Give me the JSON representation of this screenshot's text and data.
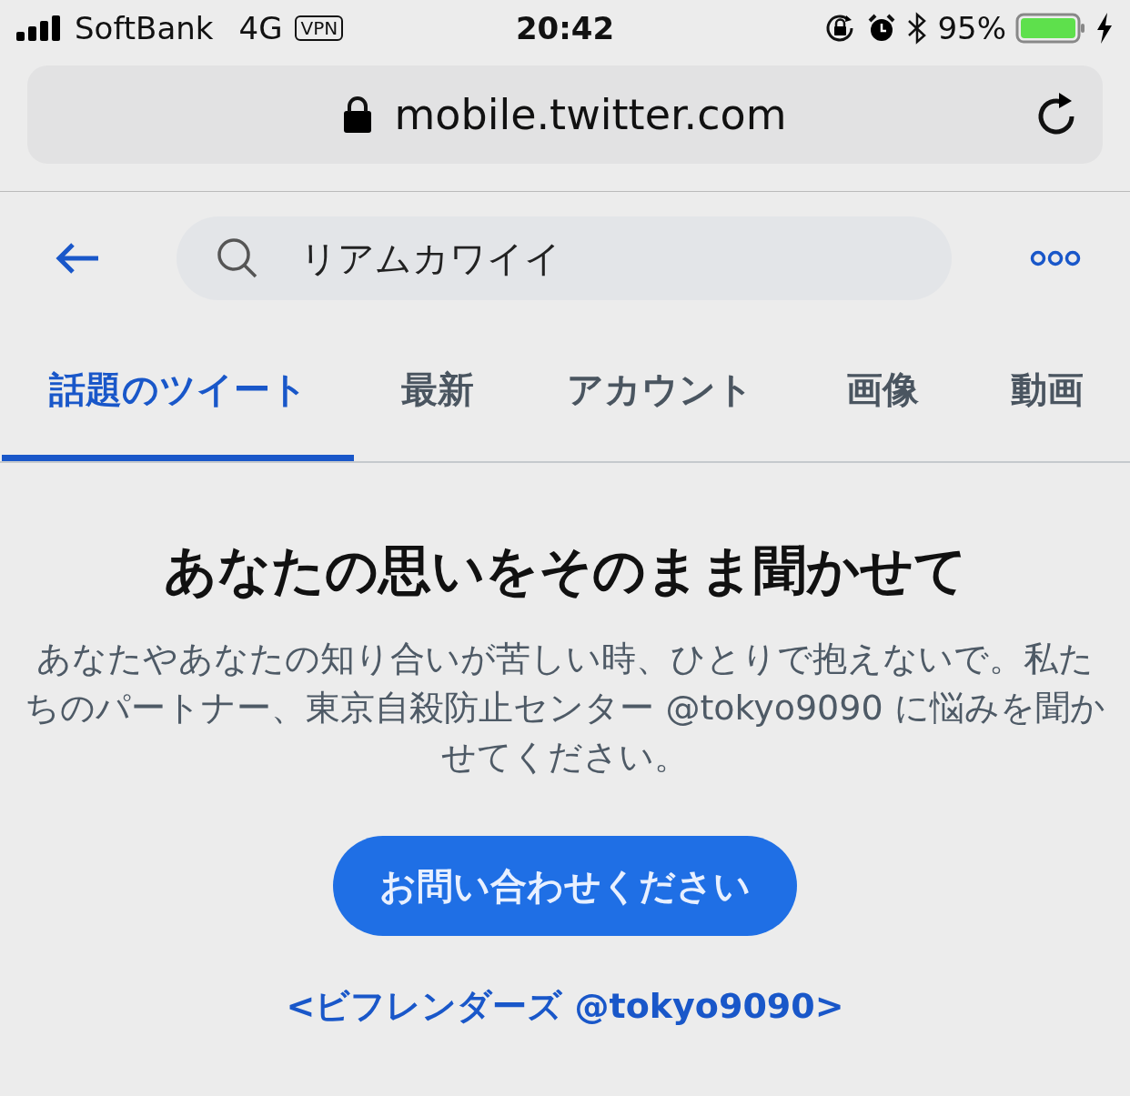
{
  "status_bar": {
    "carrier": "SoftBank",
    "network": "4G",
    "vpn": "VPN",
    "time": "20:42",
    "battery": "95%"
  },
  "address_bar": {
    "url": "mobile.twitter.com"
  },
  "search": {
    "value": "リアムカワイイ"
  },
  "tabs": [
    {
      "label": "話題のツイート",
      "selected": true
    },
    {
      "label": "最新",
      "selected": false
    },
    {
      "label": "アカウント",
      "selected": false
    },
    {
      "label": "画像",
      "selected": false
    },
    {
      "label": "動画",
      "selected": false
    }
  ],
  "notice": {
    "title": "あなたの思いをそのまま聞かせて",
    "body": "あなたやあなたの知り合いが苦しい時、ひとりで抱えないで。私たちのパートナー、東京自殺防止センター @tokyo9090 に悩みを聞かせてください。",
    "button": "お問い合わせください",
    "link": "<ビフレンダーズ @tokyo9090>"
  }
}
